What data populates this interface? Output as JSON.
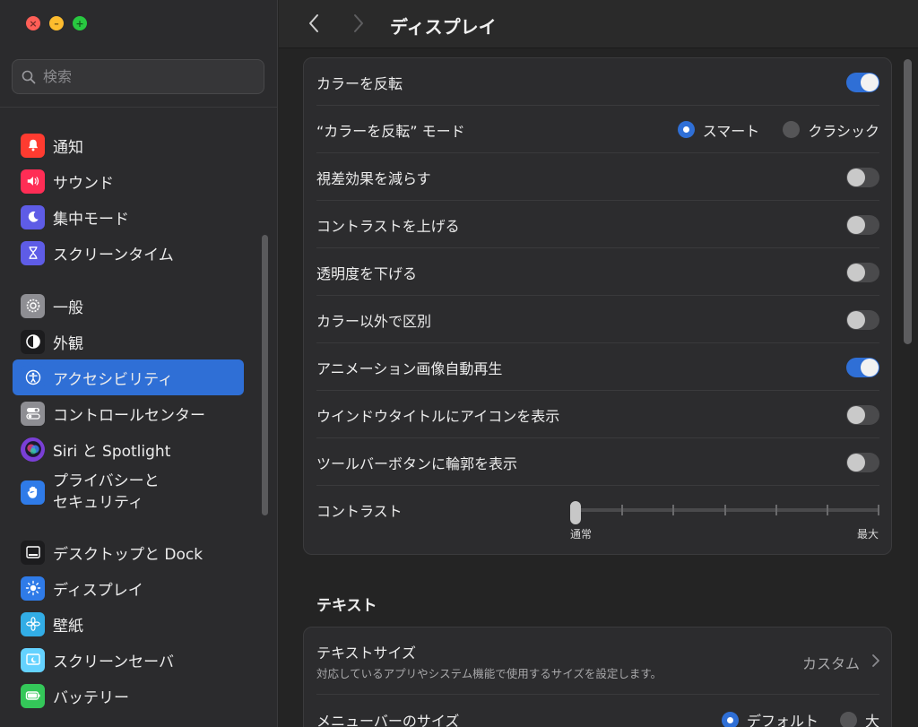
{
  "sidebar": {
    "search_placeholder": "検索",
    "groups": [
      [
        {
          "label": "通知",
          "icon": "bell-icon",
          "color": "#ff3b30"
        },
        {
          "label": "サウンド",
          "icon": "speaker-icon",
          "color": "#ff2d55"
        },
        {
          "label": "集中モード",
          "icon": "moon-icon",
          "color": "#5e5ce6"
        },
        {
          "label": "スクリーンタイム",
          "icon": "hourglass-icon",
          "color": "#5e5ce6"
        }
      ],
      [
        {
          "label": "一般",
          "icon": "gear-icon",
          "color": "#8e8e93"
        },
        {
          "label": "外観",
          "icon": "appearance-icon",
          "color": "#1c1c1e"
        },
        {
          "label": "アクセシビリティ",
          "icon": "accessibility-icon",
          "color": "#2f6fd6",
          "active": true
        },
        {
          "label": "コントロールセンター",
          "icon": "toggles-icon",
          "color": "#8e8e93"
        },
        {
          "label": "Siri と Spotlight",
          "icon": "siri-icon",
          "color": "#7a3fd6"
        },
        {
          "label": "プライバシーと\nセキュリティ",
          "icon": "hand-icon",
          "color": "#2f7be8"
        }
      ],
      [
        {
          "label": "デスクトップと Dock",
          "icon": "dock-icon",
          "color": "#1c1c1e"
        },
        {
          "label": "ディスプレイ",
          "icon": "sun-icon",
          "color": "#2f7be8"
        },
        {
          "label": "壁紙",
          "icon": "flower-icon",
          "color": "#32ade6"
        },
        {
          "label": "スクリーンセーバ",
          "icon": "screensaver-icon",
          "color": "#64d2ff"
        },
        {
          "label": "バッテリー",
          "icon": "battery-icon",
          "color": "#34c759"
        }
      ]
    ]
  },
  "toolbar": {
    "back_icon": "chevron-left-icon",
    "forward_icon": "chevron-right-icon",
    "title": "ディスプレイ"
  },
  "display": {
    "invert_colors": {
      "label": "カラーを反転",
      "on": true
    },
    "invert_mode": {
      "label": "“カラーを反転” モード",
      "options": [
        "スマート",
        "クラシック"
      ],
      "selected": "スマート"
    },
    "reduce_motion": {
      "label": "視差効果を減らす",
      "on": false
    },
    "increase_contrast": {
      "label": "コントラストを上げる",
      "on": false
    },
    "reduce_transparency": {
      "label": "透明度を下げる",
      "on": false
    },
    "differentiate_without_color": {
      "label": "カラー以外で区別",
      "on": false
    },
    "autoplay_animated_images": {
      "label": "アニメーション画像自動再生",
      "on": true
    },
    "show_window_title_icons": {
      "label": "ウインドウタイトルにアイコンを表示",
      "on": false
    },
    "show_toolbar_button_shapes": {
      "label": "ツールバーボタンに輪郭を表示",
      "on": false
    },
    "display_contrast": {
      "label": "コントラスト",
      "min_label": "通常",
      "max_label": "最大",
      "value_fraction": 0.0
    }
  },
  "text_section": {
    "title": "テキスト",
    "text_size": {
      "label": "テキストサイズ",
      "description": "対応しているアプリやシステム機能で使用するサイズを設定します。",
      "value": "カスタム"
    },
    "menu_bar_size": {
      "label": "メニューバーのサイズ",
      "options": [
        "デフォルト",
        "大"
      ],
      "selected": "デフォルト"
    }
  }
}
